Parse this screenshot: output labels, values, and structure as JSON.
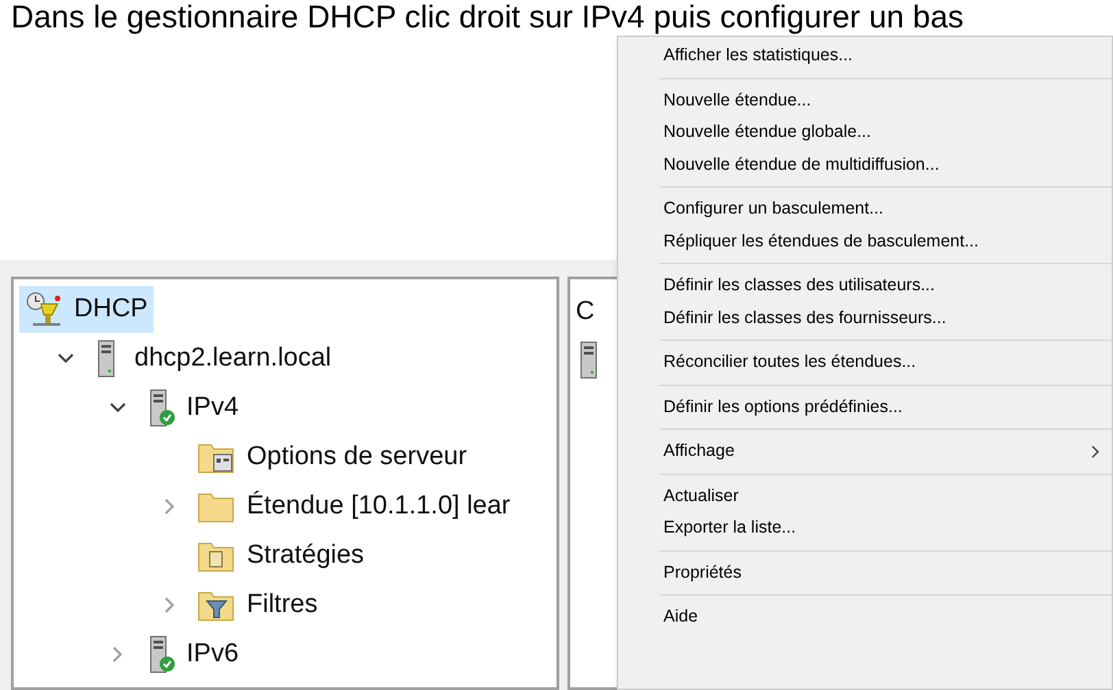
{
  "caption": "Dans le gestionnaire DHCP clic droit sur IPv4 puis configurer un bas",
  "tree": [
    {
      "label": "DHCP",
      "kind": "dhcp",
      "selected": true,
      "expandable": false,
      "children": [
        {
          "label": "dhcp2.learn.local",
          "kind": "server",
          "selected": false,
          "expandable": true,
          "expanded": true,
          "children": [
            {
              "label": "IPv4",
              "kind": "server-ok",
              "selected": false,
              "expandable": true,
              "expanded": true,
              "children": [
                {
                  "label": "Options de serveur",
                  "kind": "folder-options",
                  "selected": false,
                  "expandable": false
                },
                {
                  "label": "Étendue [10.1.1.0] lear",
                  "kind": "folder",
                  "selected": false,
                  "expandable": true,
                  "expanded": false
                },
                {
                  "label": "Stratégies",
                  "kind": "folder-policy",
                  "selected": false,
                  "expandable": false
                },
                {
                  "label": "Filtres",
                  "kind": "folder-filter",
                  "selected": false,
                  "expandable": true,
                  "expanded": false
                }
              ]
            },
            {
              "label": "IPv6",
              "kind": "server-ok",
              "selected": false,
              "expandable": true,
              "expanded": false
            }
          ]
        }
      ]
    }
  ],
  "details_pane": {
    "column_1": "C"
  },
  "context_menu": [
    [
      {
        "label": "Afficher les statistiques...",
        "kind": "item"
      }
    ],
    [
      {
        "label": "Nouvelle étendue...",
        "kind": "item"
      },
      {
        "label": "Nouvelle étendue globale...",
        "kind": "item"
      },
      {
        "label": "Nouvelle étendue de multidiffusion...",
        "kind": "item"
      }
    ],
    [
      {
        "label": "Configurer un basculement...",
        "kind": "item"
      },
      {
        "label": "Répliquer les étendues de basculement...",
        "kind": "item"
      }
    ],
    [
      {
        "label": "Définir les classes des utilisateurs...",
        "kind": "item"
      },
      {
        "label": "Définir les classes des fournisseurs...",
        "kind": "item"
      }
    ],
    [
      {
        "label": "Réconcilier toutes les étendues...",
        "kind": "item"
      }
    ],
    [
      {
        "label": "Définir les options prédéfinies...",
        "kind": "item"
      }
    ],
    [
      {
        "label": "Affichage",
        "kind": "submenu"
      }
    ],
    [
      {
        "label": "Actualiser",
        "kind": "item"
      },
      {
        "label": "Exporter la liste...",
        "kind": "item"
      }
    ],
    [
      {
        "label": "Propriétés",
        "kind": "item"
      }
    ],
    [
      {
        "label": "Aide",
        "kind": "item"
      }
    ]
  ]
}
